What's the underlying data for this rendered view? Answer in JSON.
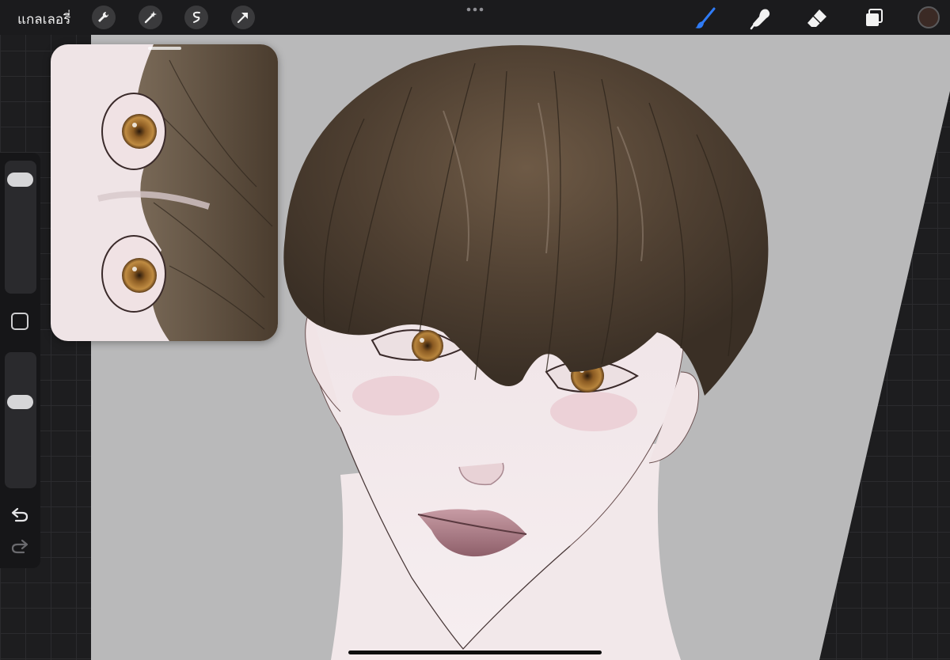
{
  "toolbar": {
    "gallery_label": "แกลเลอรี่",
    "left_tools": [
      "wrench-icon",
      "magic-wand-icon",
      "selection-icon",
      "transform-arrow-icon"
    ],
    "right_tools": [
      "brush-icon",
      "smudge-icon",
      "eraser-icon",
      "layers-icon"
    ],
    "active_tool": "brush-icon",
    "current_color": "#3b2a25",
    "accent_color": "#2f7bf5"
  },
  "sidebar": {
    "brush_size_level": 0.9,
    "opacity_level": 0.65,
    "buttons": [
      "modify-button",
      "undo-icon",
      "redo-icon"
    ]
  },
  "canvas": {
    "background_color": "#b9b9ba",
    "artwork": "portrait-illustration"
  },
  "reference": {
    "artwork": "eyes-closeup"
  }
}
